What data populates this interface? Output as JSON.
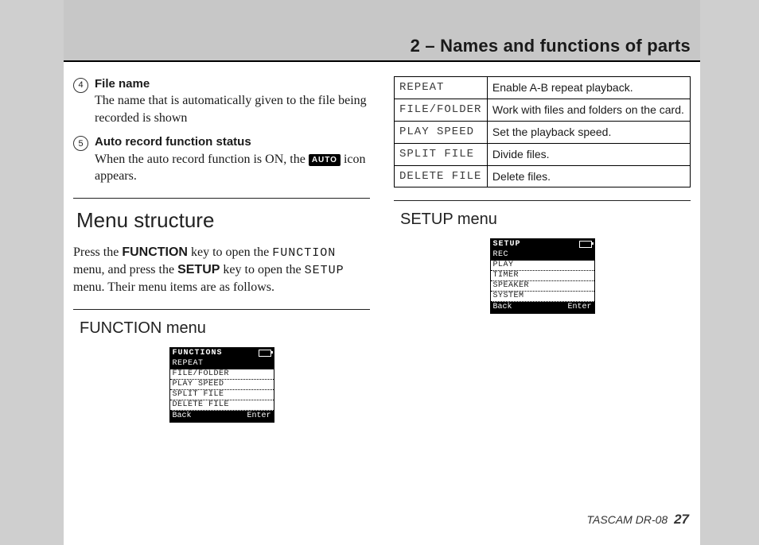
{
  "header": {
    "title": "2 – Names and functions of parts"
  },
  "left": {
    "item4": {
      "num": "4",
      "title": "File name",
      "body": "The name that is automatically given to the file being recorded is shown"
    },
    "item5": {
      "num": "5",
      "title": "Auto record function status",
      "body_pre": "When the auto record function is ON, the ",
      "badge": "AUTO",
      "body_post": " icon appears."
    },
    "menu_structure_heading": "Menu structure",
    "para_parts": {
      "p1": "Press the ",
      "k1": "FUNCTION",
      "p2": " key to open the ",
      "m1": "FUNCTION",
      "p3": " menu, and press the ",
      "k2": "SETUP",
      "p4": " key to open the ",
      "m2": "SETUP",
      "p5": " menu. Their menu items are as follows."
    },
    "function_menu_heading": "FUNCTION menu",
    "lcd_function": {
      "title": "FUNCTIONS",
      "rows": [
        "REPEAT",
        "FILE/FOLDER",
        "PLAY SPEED",
        "SPLIT FILE",
        "DELETE FILE"
      ],
      "back": "Back",
      "enter": "Enter"
    }
  },
  "right": {
    "table": [
      {
        "key": "REPEAT",
        "val": "Enable A-B repeat playback."
      },
      {
        "key": "FILE/FOLDER",
        "val": "Work with files and folders on the card."
      },
      {
        "key": "PLAY SPEED",
        "val": "Set the playback speed."
      },
      {
        "key": "SPLIT FILE",
        "val": "Divide files."
      },
      {
        "key": "DELETE FILE",
        "val": "Delete files."
      }
    ],
    "setup_menu_heading": "SETUP menu",
    "lcd_setup": {
      "title": "SETUP",
      "rows": [
        "REC",
        "PLAY",
        "TIMER",
        "SPEAKER",
        "SYSTEM"
      ],
      "back": "Back",
      "enter": "Enter"
    }
  },
  "footer": {
    "model": "TASCAM  DR-08",
    "page": "27"
  }
}
